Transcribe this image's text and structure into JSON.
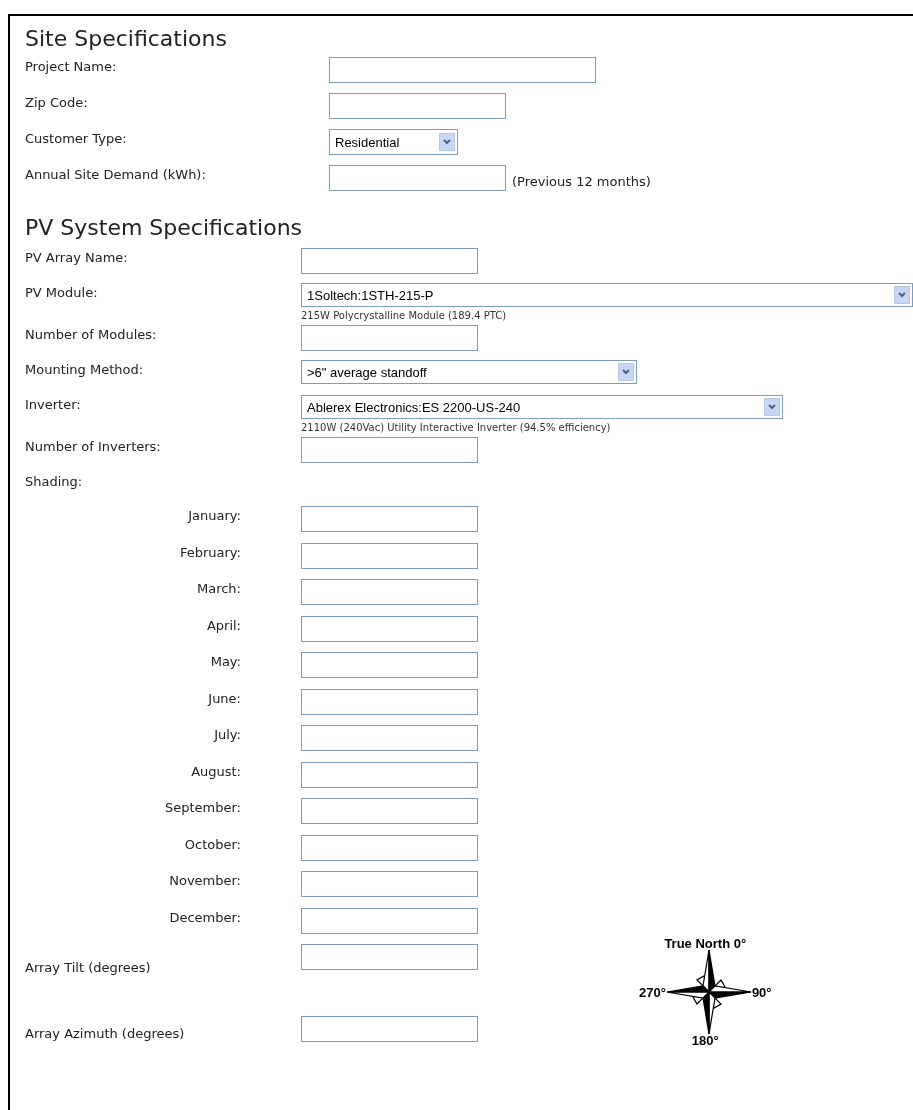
{
  "site": {
    "title": "Site Specifications",
    "fields": [
      {
        "label": "Project Name:",
        "kind": "text"
      },
      {
        "label": "Zip Code:",
        "kind": "text"
      },
      {
        "label": "Customer Type:",
        "kind": "select",
        "value": "Residential"
      },
      {
        "label": "Annual Site Demand (kWh):",
        "kind": "text",
        "note": "(Previous 12 months)"
      }
    ]
  },
  "pv": {
    "title": "PV System Specifications",
    "fields": [
      {
        "label": "PV Array Name:",
        "kind": "text"
      },
      {
        "label": "PV Module:",
        "kind": "select",
        "value": "1Soltech:1STH-215-P",
        "hint": "215W Polycrystalline Module (189.4 PTC)"
      },
      {
        "label": "Number of Modules:",
        "kind": "text"
      },
      {
        "label": "Mounting Method:",
        "kind": "select",
        "value": ">6\" average standoff"
      },
      {
        "label": "Inverter:",
        "kind": "select",
        "value": "Ablerex Electronics:ES 2200-US-240",
        "hint": "2110W (240Vac) Utility Interactive Inverter (94.5% efficiency)"
      },
      {
        "label": "Number of Inverters:",
        "kind": "text"
      }
    ],
    "shading": {
      "label": "Shading:",
      "months": [
        "January:",
        "February:",
        "March:",
        "April:",
        "May:",
        "June:",
        "July:",
        "August:",
        "September:",
        "October:",
        "November:",
        "December:"
      ]
    },
    "tilt": {
      "label": "Array Tilt (degrees)"
    },
    "azimuth": {
      "label": "Array Azimuth (degrees)"
    },
    "compass": {
      "north": "True North 0°",
      "east": "90°",
      "south": "180°",
      "west": "270°"
    }
  }
}
